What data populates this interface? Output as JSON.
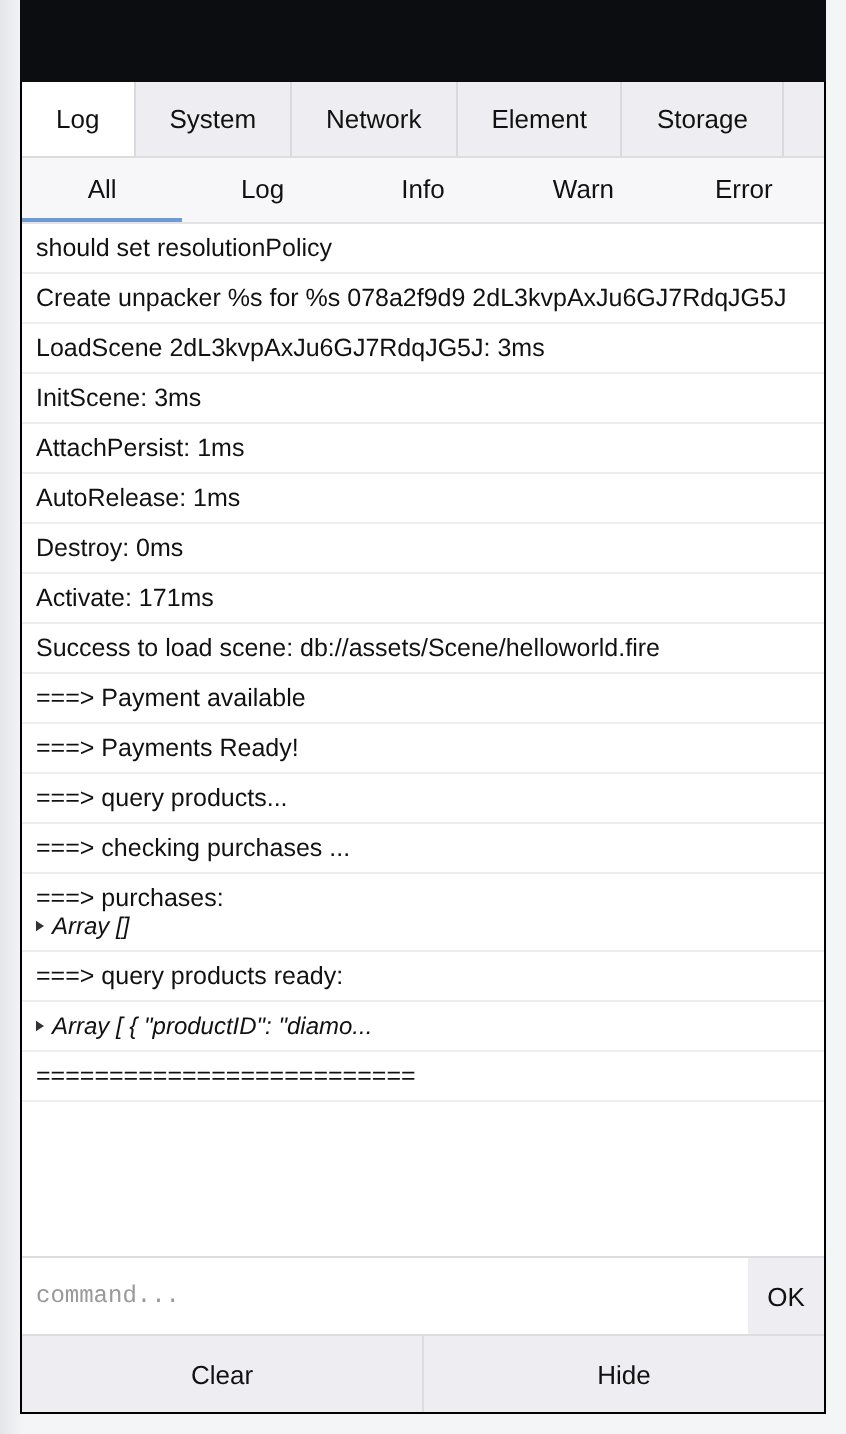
{
  "tabs": [
    {
      "label": "Log",
      "selected": true
    },
    {
      "label": "System",
      "selected": false
    },
    {
      "label": "Network",
      "selected": false
    },
    {
      "label": "Element",
      "selected": false
    },
    {
      "label": "Storage",
      "selected": false
    }
  ],
  "filters": [
    {
      "label": "All",
      "selected": true
    },
    {
      "label": "Log",
      "selected": false
    },
    {
      "label": "Info",
      "selected": false
    },
    {
      "label": "Warn",
      "selected": false
    },
    {
      "label": "Error",
      "selected": false
    }
  ],
  "log": [
    {
      "lines": [
        {
          "kind": "text",
          "text": "should set resolutionPolicy"
        }
      ]
    },
    {
      "lines": [
        {
          "kind": "text",
          "text": "Create unpacker %s for %s 078a2f9d9 2dL3kvpAxJu6GJ7RdqJG5J"
        }
      ]
    },
    {
      "lines": [
        {
          "kind": "text",
          "text": "LoadScene 2dL3kvpAxJu6GJ7RdqJG5J: 3ms"
        }
      ]
    },
    {
      "lines": [
        {
          "kind": "text",
          "text": "InitScene: 3ms"
        }
      ]
    },
    {
      "lines": [
        {
          "kind": "text",
          "text": "AttachPersist: 1ms"
        }
      ]
    },
    {
      "lines": [
        {
          "kind": "text",
          "text": "AutoRelease: 1ms"
        }
      ]
    },
    {
      "lines": [
        {
          "kind": "text",
          "text": "Destroy: 0ms"
        }
      ]
    },
    {
      "lines": [
        {
          "kind": "text",
          "text": "Activate: 171ms"
        }
      ]
    },
    {
      "lines": [
        {
          "kind": "text",
          "text": "Success to load scene: db://assets/Scene/helloworld.fire"
        }
      ]
    },
    {
      "lines": [
        {
          "kind": "text",
          "text": "===> Payment available"
        }
      ]
    },
    {
      "lines": [
        {
          "kind": "text",
          "text": "===> Payments Ready!"
        }
      ]
    },
    {
      "lines": [
        {
          "kind": "text",
          "text": "===> query products..."
        }
      ]
    },
    {
      "lines": [
        {
          "kind": "text",
          "text": "===> checking purchases ..."
        }
      ]
    },
    {
      "lines": [
        {
          "kind": "text",
          "text": "===> purchases:"
        },
        {
          "kind": "object",
          "text": "Array []"
        }
      ]
    },
    {
      "lines": [
        {
          "kind": "text",
          "text": "===> query products ready:"
        }
      ]
    },
    {
      "lines": [
        {
          "kind": "object",
          "text": "Array [ { \"productID\": \"diamo..."
        }
      ]
    },
    {
      "lines": [
        {
          "kind": "text",
          "text": "=========================="
        }
      ]
    }
  ],
  "command": {
    "placeholder": "command...",
    "button": "OK"
  },
  "toolbar": [
    "Clear",
    "Hide"
  ]
}
